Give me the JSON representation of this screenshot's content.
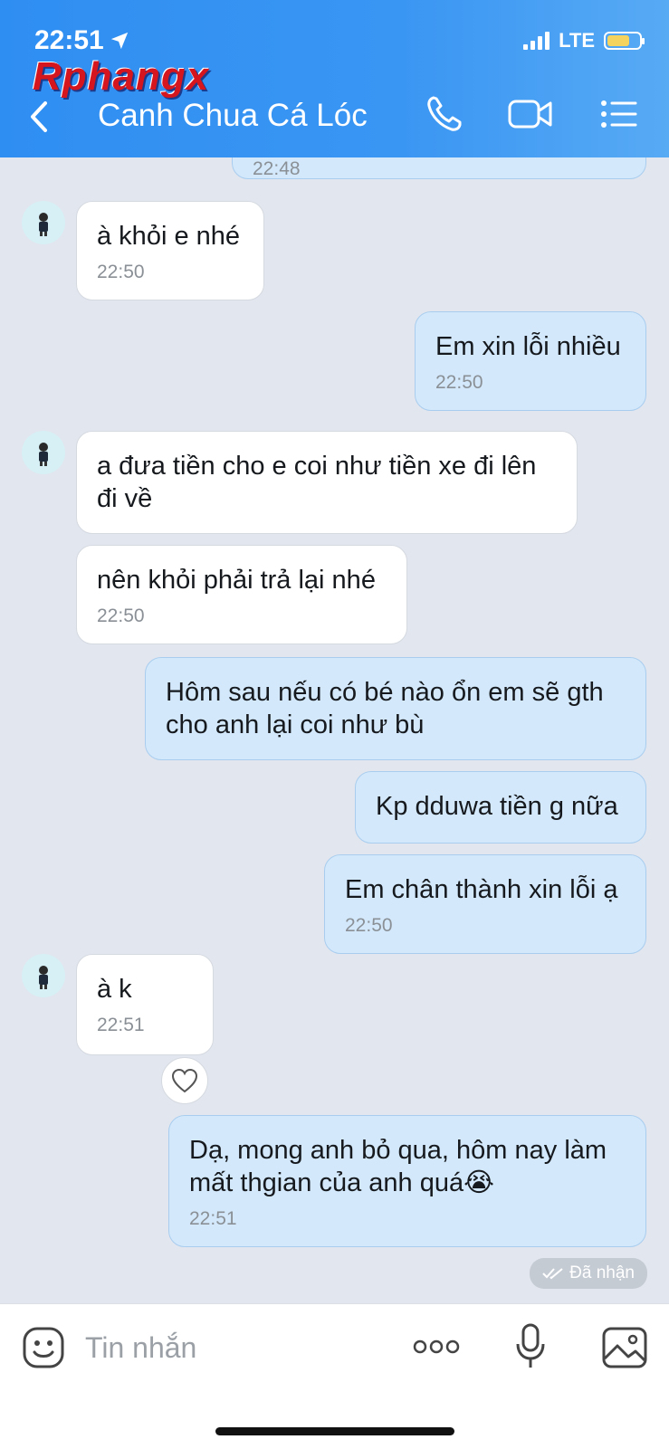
{
  "status": {
    "time": "22:51",
    "network": "LTE"
  },
  "watermark": "Rphangx",
  "header": {
    "title": "Canh Chua Cá Lóc"
  },
  "messages": [
    {
      "text": "22:48",
      "time": ""
    },
    {
      "text": "à khỏi e nhé",
      "time": "22:50"
    },
    {
      "text": "Em xin lỗi nhiều",
      "time": "22:50"
    },
    {
      "text": "a đưa tiền cho e coi như tiền xe đi lên đi về",
      "time": ""
    },
    {
      "text": "nên khỏi phải trả lại nhé",
      "time": "22:50"
    },
    {
      "text": "Hôm sau nếu có bé nào ổn em sẽ gth cho anh lại coi như bù",
      "time": ""
    },
    {
      "text": "Kp dduwa tiền g nữa",
      "time": ""
    },
    {
      "text": "Em chân thành xin lỗi ạ",
      "time": "22:50"
    },
    {
      "text": "à k",
      "time": "22:51"
    },
    {
      "text": "Dạ, mong anh bỏ qua, hôm nay làm mất thgian của anh quá😭",
      "time": "22:51"
    }
  ],
  "received_label": "Đã nhận",
  "composer": {
    "placeholder": "Tin nhắn"
  },
  "colors": {
    "header": "#3a96f3",
    "outgoing": "#d3e9fb",
    "incoming": "#ffffff",
    "background": "#e2e6ee"
  }
}
